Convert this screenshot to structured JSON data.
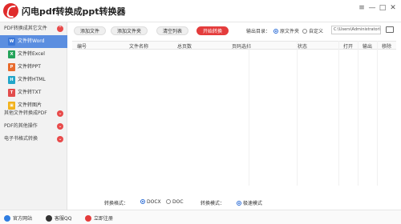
{
  "window": {
    "title": "闪电pdf转换成ppt转换器",
    "controls": [
      "≡",
      "—",
      "□",
      "✕"
    ]
  },
  "sidebar": {
    "category_pdf": "PDF转换成其它文件",
    "items": [
      {
        "label": "文件转Word",
        "icon": "W",
        "color": "#3d78d8",
        "active": true
      },
      {
        "label": "文件转Excel",
        "icon": "X",
        "color": "#24a35a",
        "active": false
      },
      {
        "label": "文件转PPT",
        "icon": "P",
        "color": "#e86a2c",
        "active": false
      },
      {
        "label": "文件转HTML",
        "icon": "H",
        "color": "#22a6c9",
        "active": false
      },
      {
        "label": "文件转TXT",
        "icon": "T",
        "color": "#e24c4c",
        "active": false
      },
      {
        "label": "文件转图片",
        "icon": "▣",
        "color": "#f2b21c",
        "active": false
      }
    ],
    "category_other": "其他文件转换成PDF",
    "category_ops": "PDF的其他操作",
    "category_ebook": "电子书格式转换"
  },
  "toolbar": {
    "add_file": "添加文件",
    "add_folder": "添加文件夹",
    "clear_list": "清空列表",
    "start": "开始转换",
    "output_label": "输出目录：",
    "source_folder": "原文件夹",
    "custom": "自定义",
    "path": "C:\\Users\\Administrator\\Des"
  },
  "table": {
    "columns": [
      "编号",
      "文件名称",
      "总页数",
      "页码选择",
      "状态",
      "打开",
      "输出",
      "移除"
    ]
  },
  "options": {
    "format_label": "转换格式：",
    "docx": "DOCX",
    "doc": "DOC",
    "mode_label": "转换模式：",
    "mode_value": "极速模式"
  },
  "status": {
    "website": "官方网站",
    "qq": "客服QQ",
    "register": "立即注册"
  }
}
